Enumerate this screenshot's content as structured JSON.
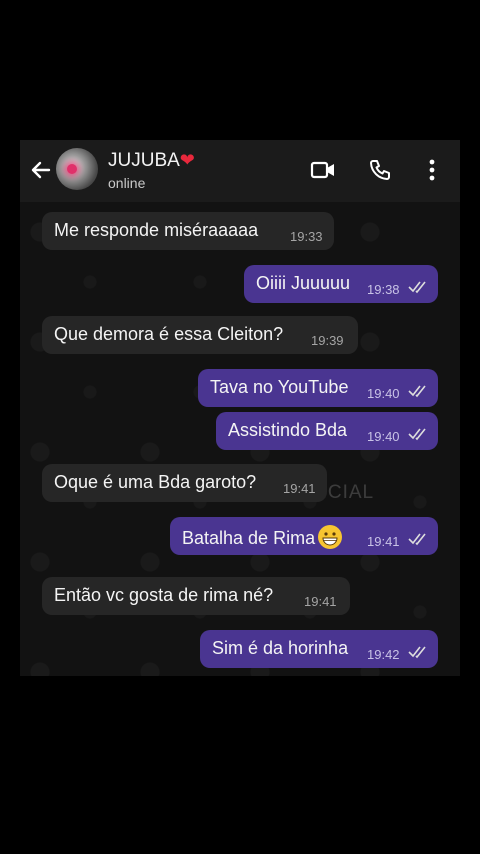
{
  "contact": {
    "name": "JUJUBA",
    "heart": "❤",
    "status": "online"
  },
  "watermark": "@DRL_SANTOS_OFICIAL",
  "messages": [
    {
      "dir": "in",
      "text": "Me responde miséraaaaa",
      "time": "19:33"
    },
    {
      "dir": "out",
      "text": "Oiiii Juuuuu",
      "time": "19:38"
    },
    {
      "dir": "in",
      "text": "Que demora é essa Cleiton?",
      "time": "19:39"
    },
    {
      "dir": "out",
      "text": "Tava no YouTube",
      "time": "19:40"
    },
    {
      "dir": "out",
      "text": "Assistindo Bda",
      "time": "19:40"
    },
    {
      "dir": "in",
      "text": "Oque é uma Bda garoto?",
      "time": "19:41"
    },
    {
      "dir": "out",
      "text": "Batalha de Rima",
      "emoji": "grinning-face",
      "time": "19:41"
    },
    {
      "dir": "in",
      "text": "Então vc gosta de rima né?",
      "time": "19:41"
    },
    {
      "dir": "out",
      "text": "Sim é da horinha",
      "time": "19:42"
    }
  ],
  "colors": {
    "outgoing_bubble": "#4a3591",
    "incoming_bubble": "#262626",
    "chat_bg": "#121212",
    "header_bg": "#1b1b1b"
  },
  "icons": [
    "back-arrow-icon",
    "video-call-icon",
    "phone-icon",
    "more-vert-icon",
    "double-check-icon"
  ]
}
